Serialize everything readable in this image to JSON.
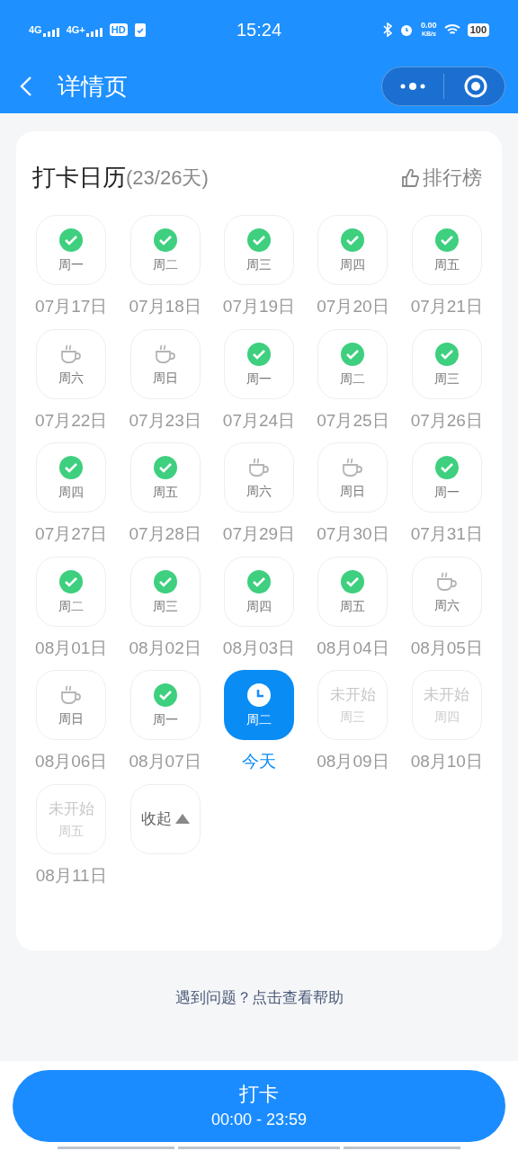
{
  "status_bar": {
    "left": [
      "4G",
      "4G+",
      "HD"
    ],
    "time": "15:24",
    "speed": "0.00",
    "speed_unit": "KB/s",
    "battery": "100"
  },
  "nav": {
    "title": "详情页"
  },
  "calendar": {
    "title": "打卡日历",
    "count": "(23/26天)",
    "ranking": "排行榜",
    "days": [
      {
        "kind": "done",
        "weekday": "周一",
        "date": "07月17日"
      },
      {
        "kind": "done",
        "weekday": "周二",
        "date": "07月18日"
      },
      {
        "kind": "done",
        "weekday": "周三",
        "date": "07月19日"
      },
      {
        "kind": "done",
        "weekday": "周四",
        "date": "07月20日"
      },
      {
        "kind": "done",
        "weekday": "周五",
        "date": "07月21日"
      },
      {
        "kind": "rest",
        "weekday": "周六",
        "date": "07月22日"
      },
      {
        "kind": "rest",
        "weekday": "周日",
        "date": "07月23日"
      },
      {
        "kind": "done",
        "weekday": "周一",
        "date": "07月24日"
      },
      {
        "kind": "done",
        "weekday": "周二",
        "date": "07月25日"
      },
      {
        "kind": "done",
        "weekday": "周三",
        "date": "07月26日"
      },
      {
        "kind": "done",
        "weekday": "周四",
        "date": "07月27日"
      },
      {
        "kind": "done",
        "weekday": "周五",
        "date": "07月28日"
      },
      {
        "kind": "rest",
        "weekday": "周六",
        "date": "07月29日"
      },
      {
        "kind": "rest",
        "weekday": "周日",
        "date": "07月30日"
      },
      {
        "kind": "done",
        "weekday": "周一",
        "date": "07月31日"
      },
      {
        "kind": "done",
        "weekday": "周二",
        "date": "08月01日"
      },
      {
        "kind": "done",
        "weekday": "周三",
        "date": "08月02日"
      },
      {
        "kind": "done",
        "weekday": "周四",
        "date": "08月03日"
      },
      {
        "kind": "done",
        "weekday": "周五",
        "date": "08月04日"
      },
      {
        "kind": "rest",
        "weekday": "周六",
        "date": "08月05日"
      },
      {
        "kind": "rest",
        "weekday": "周日",
        "date": "08月06日"
      },
      {
        "kind": "done",
        "weekday": "周一",
        "date": "08月07日"
      },
      {
        "kind": "today",
        "weekday": "周二",
        "date": "今天"
      },
      {
        "kind": "upcoming",
        "status": "未开始",
        "weekday": "周三",
        "date": "08月09日"
      },
      {
        "kind": "upcoming",
        "status": "未开始",
        "weekday": "周四",
        "date": "08月10日"
      },
      {
        "kind": "upcoming",
        "status": "未开始",
        "weekday": "周五",
        "date": "08月11日"
      }
    ],
    "collapse": "收起"
  },
  "help_link": "遇到问题？点击查看帮助",
  "checkin_button": {
    "label": "打卡",
    "hours": "00:00 - 23:59"
  }
}
